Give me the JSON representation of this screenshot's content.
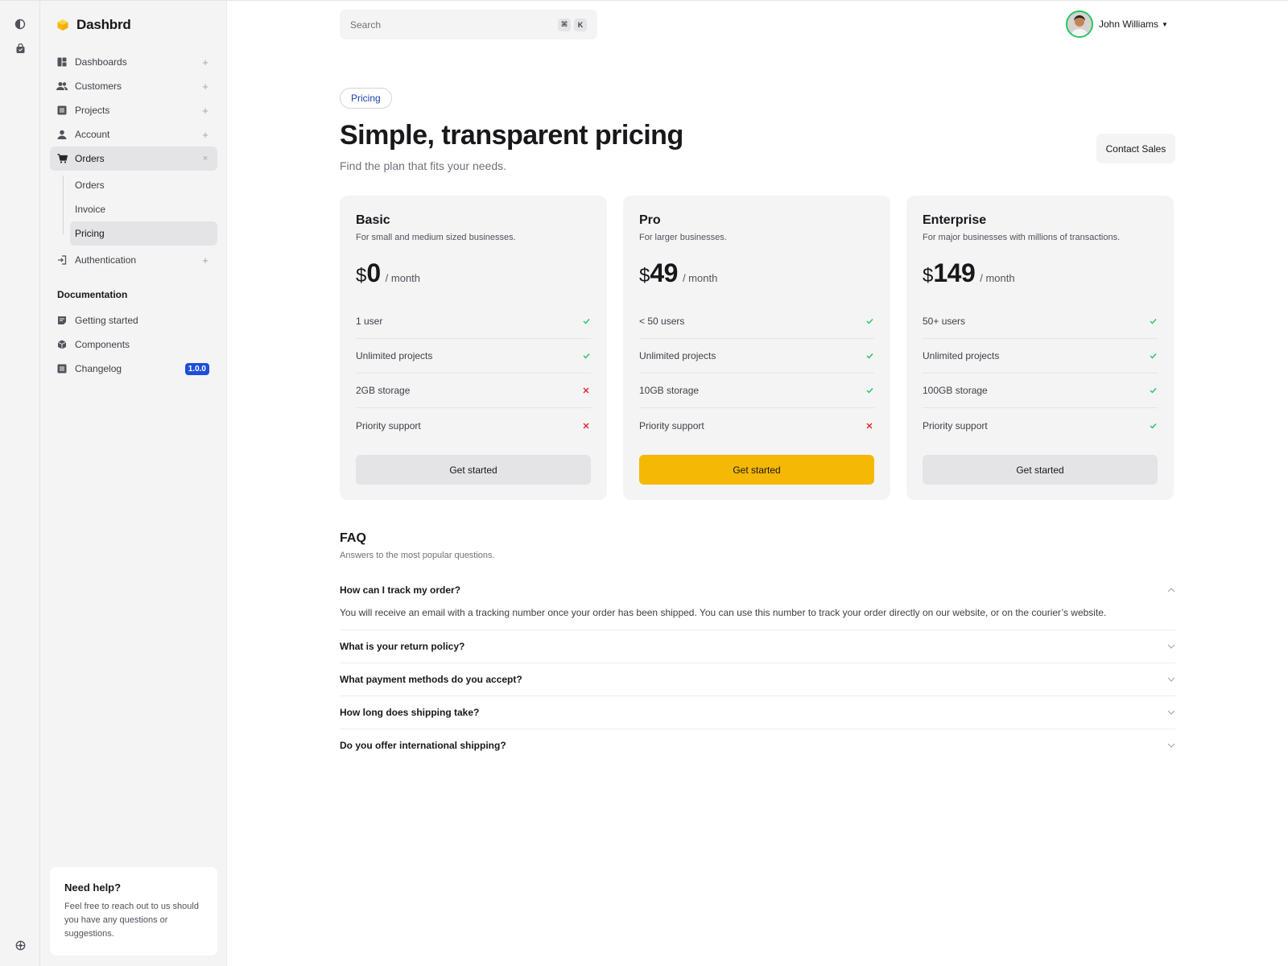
{
  "app": {
    "name": "Dashbrd",
    "brand_color": "#f5b805"
  },
  "rail": {
    "icons": [
      "theme-toggle-icon",
      "bag-icon",
      "settings-icon"
    ]
  },
  "sidebar": {
    "items": [
      {
        "label": "Dashboards",
        "icon": "dashboard-icon"
      },
      {
        "label": "Customers",
        "icon": "users-icon"
      },
      {
        "label": "Projects",
        "icon": "list-icon"
      },
      {
        "label": "Account",
        "icon": "person-icon"
      },
      {
        "label": "Orders",
        "icon": "cart-icon",
        "expanded": true
      },
      {
        "label": "Authentication",
        "icon": "login-icon"
      }
    ],
    "orders_sub": [
      {
        "label": "Orders"
      },
      {
        "label": "Invoice"
      },
      {
        "label": "Pricing",
        "active": true
      }
    ],
    "docs_title": "Documentation",
    "docs": [
      {
        "label": "Getting started",
        "icon": "doc-icon"
      },
      {
        "label": "Components",
        "icon": "cube-icon"
      },
      {
        "label": "Changelog",
        "icon": "list-icon",
        "badge": "1.0.0"
      }
    ],
    "help": {
      "title": "Need help?",
      "text": "Feel free to reach out to us should you have any questions or suggestions."
    }
  },
  "topbar": {
    "search_placeholder": "Search",
    "shortcut": [
      "⌘",
      "K"
    ],
    "user_name": "John Williams"
  },
  "header": {
    "chip": "Pricing",
    "title": "Simple, transparent pricing",
    "subtitle": "Find the plan that fits your needs.",
    "contact_label": "Contact Sales"
  },
  "plans": [
    {
      "name": "Basic",
      "description": "For small and medium sized businesses.",
      "currency": "$",
      "price": "0",
      "period": "/ month",
      "features": [
        {
          "label": "1 user",
          "included": true
        },
        {
          "label": "Unlimited projects",
          "included": true
        },
        {
          "label": "2GB storage",
          "included": false
        },
        {
          "label": "Priority support",
          "included": false
        }
      ],
      "cta": "Get started",
      "highlighted": false
    },
    {
      "name": "Pro",
      "description": "For larger businesses.",
      "currency": "$",
      "price": "49",
      "period": "/ month",
      "features": [
        {
          "label": "< 50 users",
          "included": true
        },
        {
          "label": "Unlimited projects",
          "included": true
        },
        {
          "label": "10GB storage",
          "included": true
        },
        {
          "label": "Priority support",
          "included": false
        }
      ],
      "cta": "Get started",
      "highlighted": true
    },
    {
      "name": "Enterprise",
      "description": "For major businesses with millions of transactions.",
      "currency": "$",
      "price": "149",
      "period": "/ month",
      "features": [
        {
          "label": "50+ users",
          "included": true
        },
        {
          "label": "Unlimited projects",
          "included": true
        },
        {
          "label": "100GB storage",
          "included": true
        },
        {
          "label": "Priority support",
          "included": true
        }
      ],
      "cta": "Get started",
      "highlighted": false
    }
  ],
  "faq": {
    "title": "FAQ",
    "subtitle": "Answers to the most popular questions.",
    "items": [
      {
        "question": "How can I track my order?",
        "answer": "You will receive an email with a tracking number once your order has been shipped. You can use this number to track your order directly on our website, or on the courier’s website.",
        "open": true
      },
      {
        "question": "What is your return policy?",
        "open": false
      },
      {
        "question": "What payment methods do you accept?",
        "open": false
      },
      {
        "question": "How long does shipping take?",
        "open": false
      },
      {
        "question": "Do you offer international shipping?",
        "open": false
      }
    ]
  },
  "colors": {
    "check": "#22c55e",
    "cross": "#dc2626",
    "badge": "#1d4ed8"
  }
}
